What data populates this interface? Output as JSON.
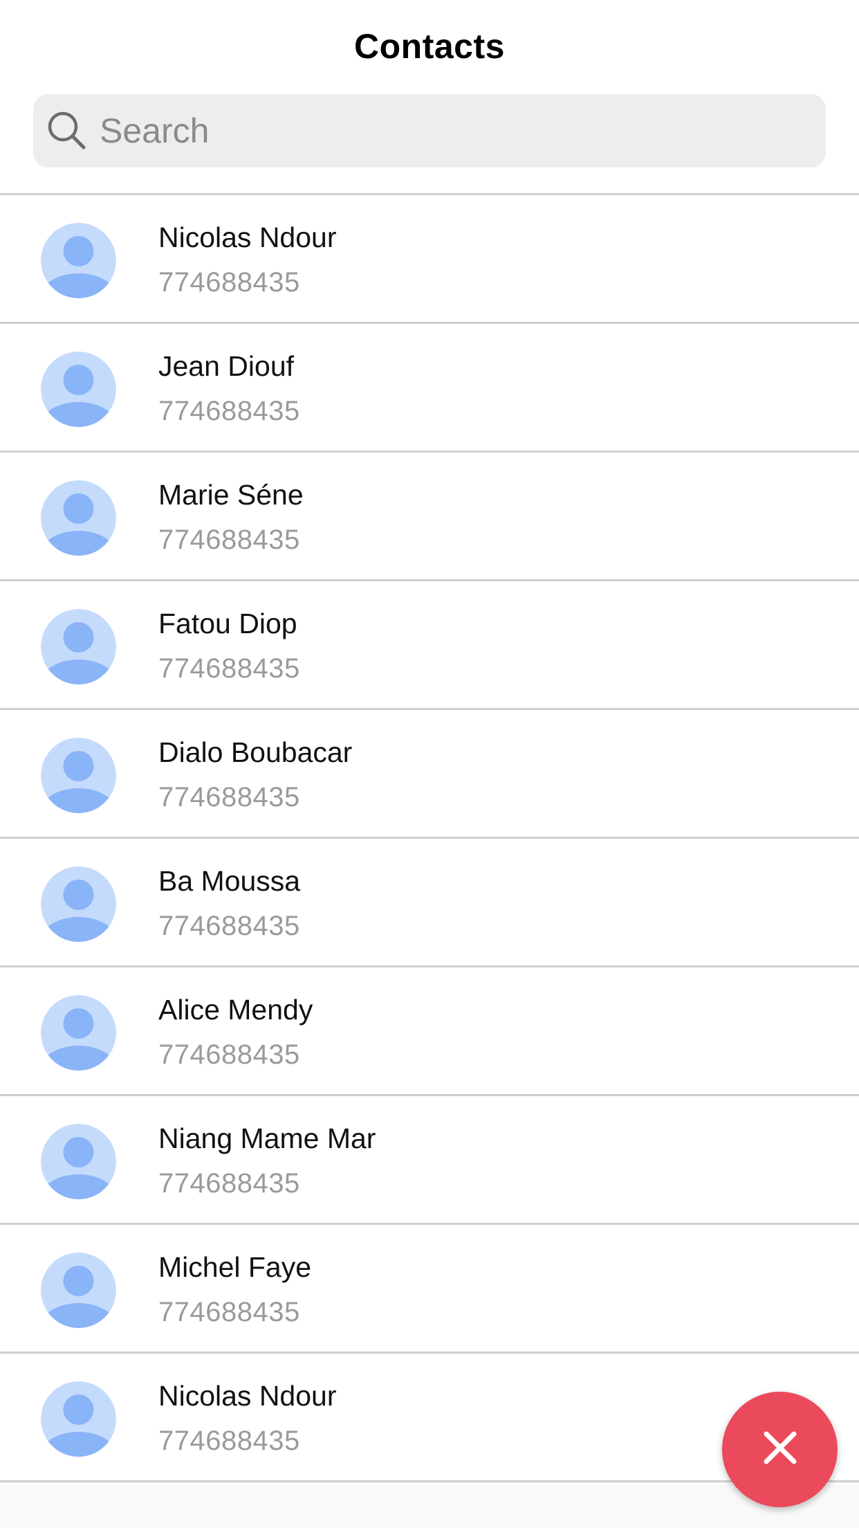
{
  "header": {
    "title": "Contacts"
  },
  "search": {
    "placeholder": "Search",
    "value": "",
    "icon": "search-icon"
  },
  "contacts": [
    {
      "name": "Nicolas Ndour",
      "phone": "774688435"
    },
    {
      "name": "Jean Diouf",
      "phone": "774688435"
    },
    {
      "name": "Marie Séne",
      "phone": "774688435"
    },
    {
      "name": "Fatou Diop",
      "phone": "774688435"
    },
    {
      "name": "Dialo Boubacar",
      "phone": "774688435"
    },
    {
      "name": "Ba Moussa",
      "phone": "774688435"
    },
    {
      "name": "Alice Mendy",
      "phone": "774688435"
    },
    {
      "name": "Niang Mame Mar",
      "phone": "774688435"
    },
    {
      "name": "Michel Faye",
      "phone": "774688435"
    },
    {
      "name": "Nicolas Ndour",
      "phone": "774688435"
    }
  ],
  "fab": {
    "icon": "close-icon",
    "color": "#ea4a5c"
  },
  "colors": {
    "avatar_bg": "#c5dbfb",
    "avatar_fg": "#8ab4f8",
    "separator": "#cfcfcf"
  }
}
